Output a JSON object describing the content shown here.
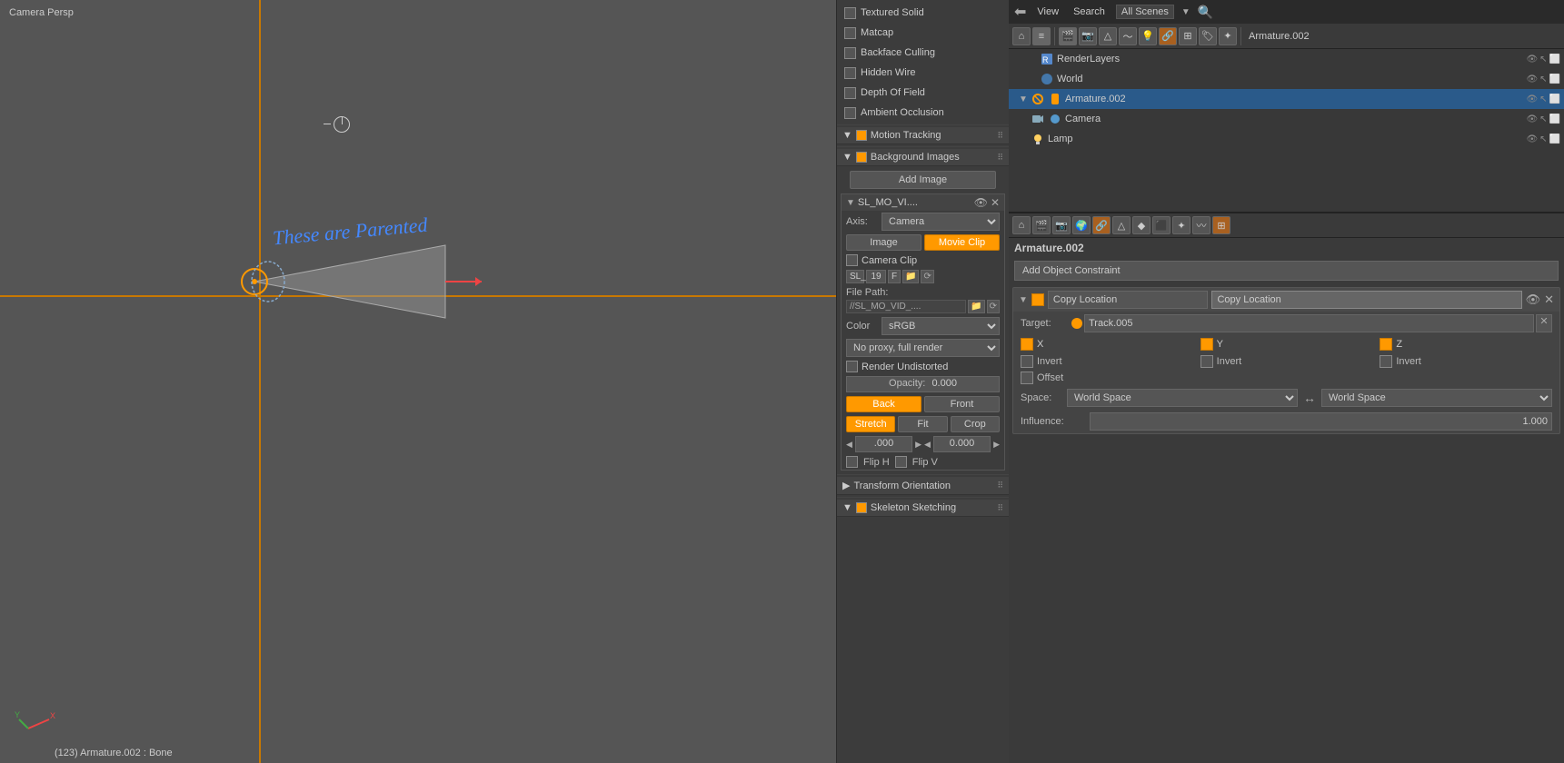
{
  "viewport": {
    "label": "Camera Persp",
    "status": "(123) Armature.002 : Bone",
    "handwriting": "These are Parented"
  },
  "shading": {
    "title": "Textured Solid",
    "items": [
      {
        "label": "Textured Solid",
        "checked": false
      },
      {
        "label": "Matcap",
        "checked": false
      },
      {
        "label": "Backface Culling",
        "checked": false
      },
      {
        "label": "Hidden Wire",
        "checked": false
      },
      {
        "label": "Depth Of Field",
        "checked": false
      },
      {
        "label": "Ambient Occlusion",
        "checked": false
      }
    ]
  },
  "motion_tracking": {
    "label": "Motion Tracking",
    "checked": true
  },
  "background_images": {
    "label": "Background Images",
    "checked": true
  },
  "add_image_btn": "Add Image",
  "movie_block": {
    "title": "SL_MO_VI....",
    "axis_label": "Axis:",
    "axis_value": "Camera",
    "image_btn": "Image",
    "movie_clip_btn": "Movie Clip",
    "camera_clip_label": "Camera Clip",
    "file_prefix": "SL_",
    "file_num": "19",
    "file_flag": "F",
    "file_path_label": "File Path:",
    "file_path_value": "//SL_MO_VID_....",
    "color_label": "Color",
    "color_value": "sRGB",
    "proxy_value": "No proxy, full render",
    "render_undistorted": "Render Undistorted",
    "opacity_label": "Opacity:",
    "opacity_value": "0.000",
    "back_btn": "Back",
    "front_btn": "Front",
    "stretch_btn": "Stretch",
    "fit_btn": "Fit",
    "crop_btn": "Crop",
    "x_val": ".000",
    "y_val": "0.000",
    "flip_h": "Flip H",
    "flip_v": "Flip V"
  },
  "transform_orientation": {
    "label": "Transform Orientation",
    "arrow": "▶"
  },
  "skeleton_sketching": {
    "label": "Skeleton Sketching",
    "checked": true
  },
  "outliner": {
    "view_label": "View",
    "search_label": "Search",
    "all_scenes_label": "All Scenes"
  },
  "object_name": "Armature.002",
  "tree": {
    "items": [
      {
        "label": "RenderLayers",
        "indent": 1,
        "type": "renderlayer",
        "has_arrow": false
      },
      {
        "label": "World",
        "indent": 1,
        "type": "world",
        "has_arrow": false
      },
      {
        "label": "Armature.002",
        "indent": 1,
        "type": "armature",
        "has_arrow": true,
        "selected": true
      },
      {
        "label": "Camera",
        "indent": 1,
        "type": "camera",
        "has_arrow": false
      },
      {
        "label": "Lamp",
        "indent": 1,
        "type": "lamp",
        "has_arrow": false
      }
    ]
  },
  "add_constraint_btn": "Add Object Constraint",
  "copy_location": {
    "name": "Copy Location",
    "name_field": "Copy Location",
    "target_label": "Target:",
    "target_value": "Track.005",
    "x_label": "X",
    "y_label": "Y",
    "z_label": "Z",
    "invert_label": "Invert",
    "offset_label": "Offset",
    "space_label": "Space:",
    "space1_value": "World Space",
    "space2_value": "World Space",
    "influence_label": "Influence:",
    "influence_value": "1.000"
  }
}
